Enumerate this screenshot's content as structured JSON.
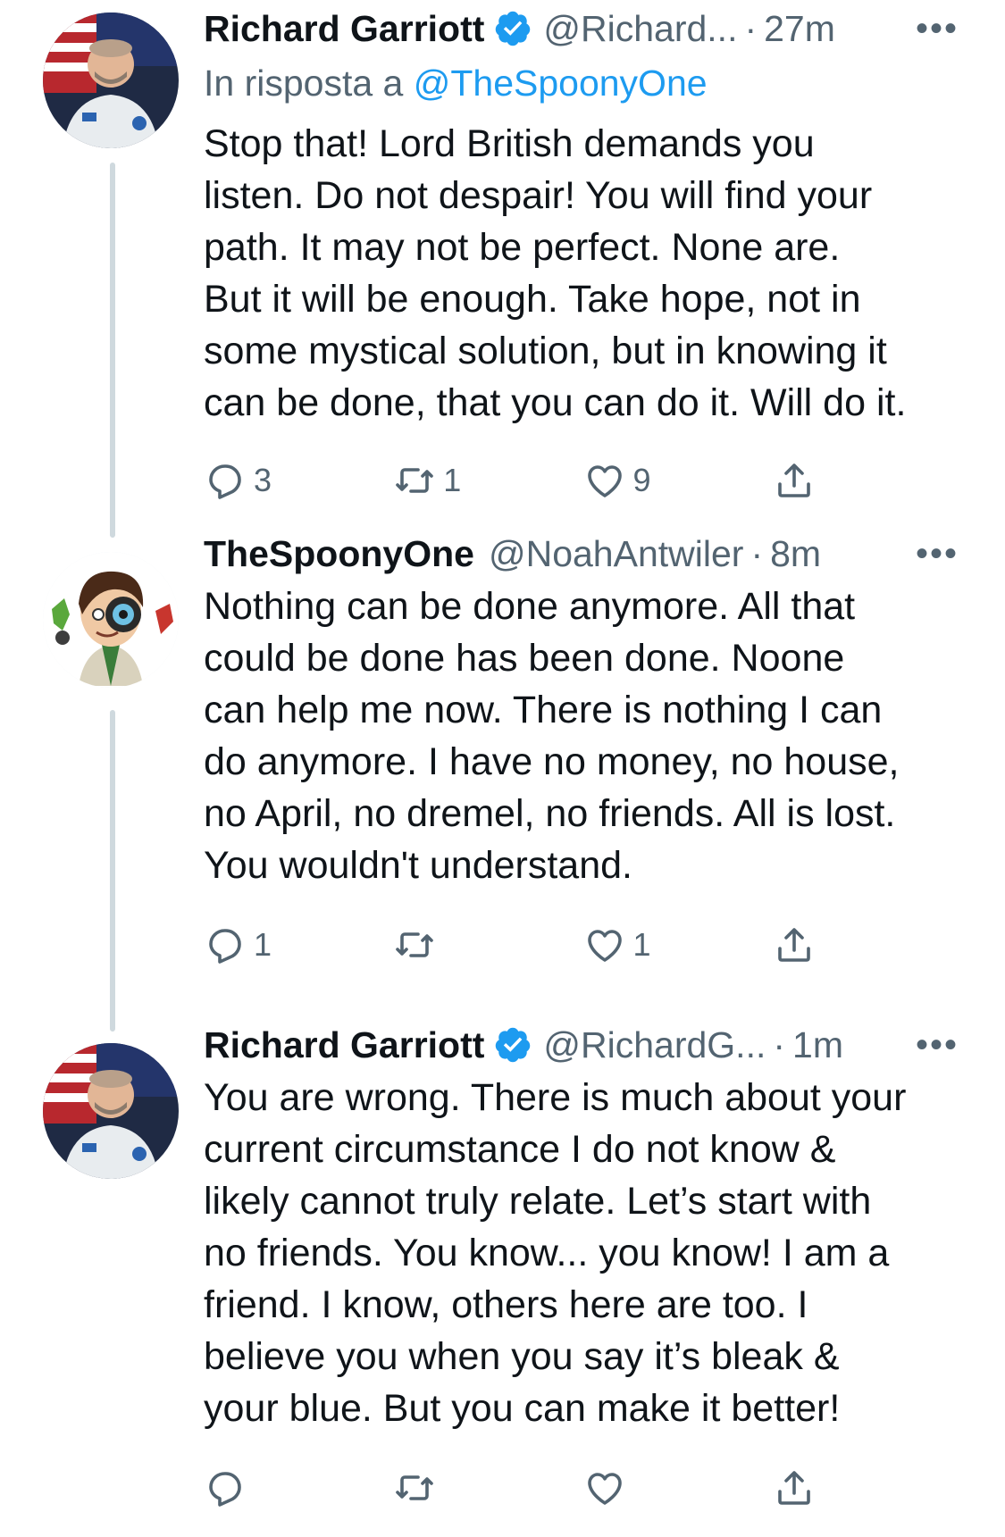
{
  "tweets": [
    {
      "name": "Richard Garriott",
      "handle": "@Richard...",
      "time": "27m",
      "more": "•••",
      "reply_prefix": "In risposta a ",
      "reply_mention": "@TheSpoonyOne",
      "text": "Stop that! Lord British demands you\nlisten. Do not despair! You will find your\npath. It may not be perfect. None are.\nBut it will be enough.  Take hope, not in\nsome mystical solution, but in knowing it\ncan be done, that you can do it. Will do it.",
      "replies": "3",
      "retweets": "1",
      "likes": "9"
    },
    {
      "name": "TheSpoonyOne",
      "handle": "@NoahAntwiler",
      "time": "8m",
      "more": "•••",
      "text": "Nothing can be done anymore. All that\ncould be done has been done. Noone\ncan help me now. There is nothing I can\ndo anymore. I have no money, no house,\nno April, no dremel, no friends. All is lost.\nYou wouldn't understand.",
      "replies": "1",
      "retweets": "",
      "likes": "1"
    },
    {
      "name": "Richard Garriott",
      "handle": "@RichardG...",
      "time": "1m",
      "more": "•••",
      "text": "You are wrong. There is much about your\ncurrent circumstance I do not know &\nlikely cannot truly relate. Let’s start with\nno friends. You know... you know! I am a\nfriend. I know, others here are too. I\nbelieve you when you say it’s bleak &\nyour blue. But you can make it better!",
      "replies": "",
      "retweets": "",
      "likes": ""
    }
  ],
  "colors": {
    "link": "#1d9bf0",
    "secondary": "#536471",
    "thread_line": "#cfd9de"
  },
  "icons": [
    "verified-badge-icon",
    "reply-icon",
    "retweet-icon",
    "like-icon",
    "share-icon",
    "more-icon"
  ]
}
